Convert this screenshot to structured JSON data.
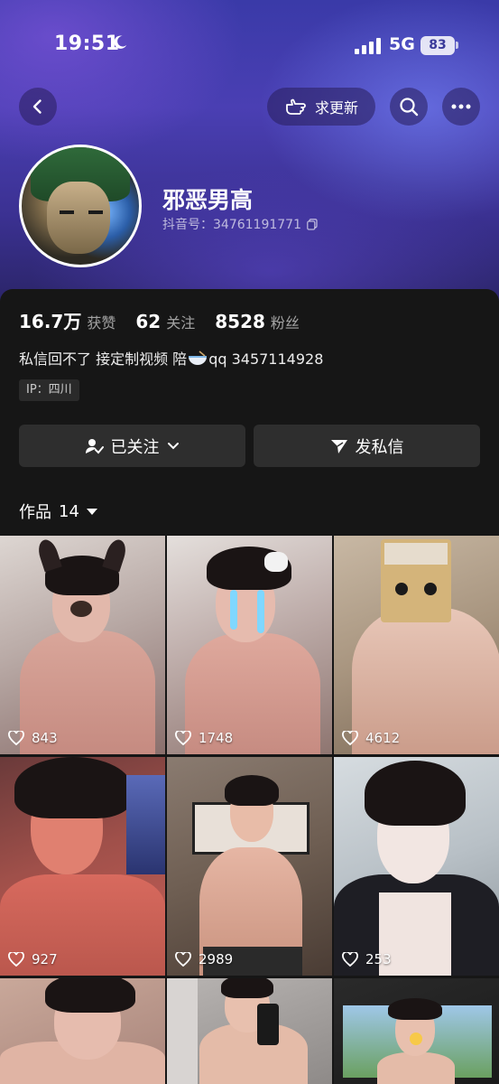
{
  "status_bar": {
    "time": "19:51",
    "network": "5G",
    "battery": "83"
  },
  "nav": {
    "update_label": "求更新"
  },
  "profile": {
    "name": "邪恶男高",
    "douyin_id": "抖音号：34761191771",
    "bio_before": "私信回不了 接定制视频 陪",
    "bio_after": "qq 3457114928",
    "ip": "IP：四川"
  },
  "stats": [
    {
      "value": "16.7万",
      "label": "获赞"
    },
    {
      "value": "62",
      "label": "关注"
    },
    {
      "value": "8528",
      "label": "粉丝"
    }
  ],
  "actions": {
    "follow_label": "已关注",
    "message_label": "发私信"
  },
  "works": {
    "label": "作品",
    "count": "14"
  },
  "videos": [
    {
      "likes": "843"
    },
    {
      "likes": "1748"
    },
    {
      "likes": "4612"
    },
    {
      "likes": "927"
    },
    {
      "likes": "2989"
    },
    {
      "likes": "253"
    },
    {
      "likes": ""
    },
    {
      "likes": ""
    },
    {
      "likes": ""
    }
  ],
  "colors": {
    "panel": "#161616",
    "button": "#2e2e2e",
    "header_gradient": "#3a3aa8"
  }
}
